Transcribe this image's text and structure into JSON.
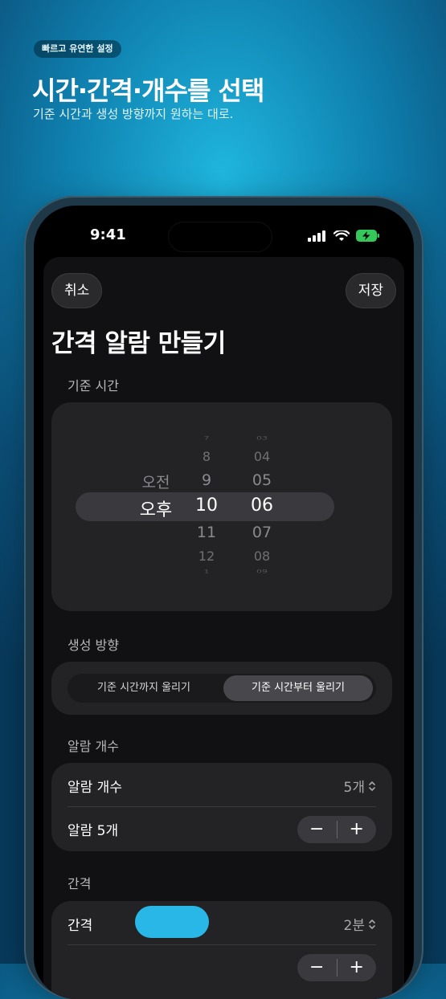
{
  "hero": {
    "badge": "빠르고 유연한 설정",
    "title": "시간·간격·개수를 선택",
    "subtitle": "기준 시간과 생성 방향까지 원하는 대로."
  },
  "status_bar": {
    "time": "9:41",
    "battery_color": "#34c759"
  },
  "sheet": {
    "cancel_label": "취소",
    "save_label": "저장",
    "title": "간격 알람 만들기"
  },
  "base_time": {
    "label": "기준 시간",
    "ampm_options": [
      "오전",
      "오후"
    ],
    "selected_ampm": "오후",
    "hours": [
      "7",
      "8",
      "9",
      "10",
      "11",
      "12",
      "1"
    ],
    "selected_hour": "10",
    "minutes": [
      "03",
      "04",
      "05",
      "06",
      "07",
      "08",
      "09"
    ],
    "selected_minute": "06"
  },
  "direction": {
    "label": "생성 방향",
    "options": [
      "기준 시간까지 울리기",
      "기준 시간부터 울리기"
    ],
    "selected": "기준 시간부터 울리기"
  },
  "alarm_count": {
    "label": "알람 개수",
    "row_label": "알람 개수",
    "row_value": "5개",
    "stepper_label": "알람 5개",
    "minus": "−",
    "plus": "+"
  },
  "interval": {
    "label": "간격",
    "row_label": "간격",
    "row_value": "2분"
  },
  "colors": {
    "accent": "#29c0f0",
    "background_top": "#1fb6de"
  }
}
